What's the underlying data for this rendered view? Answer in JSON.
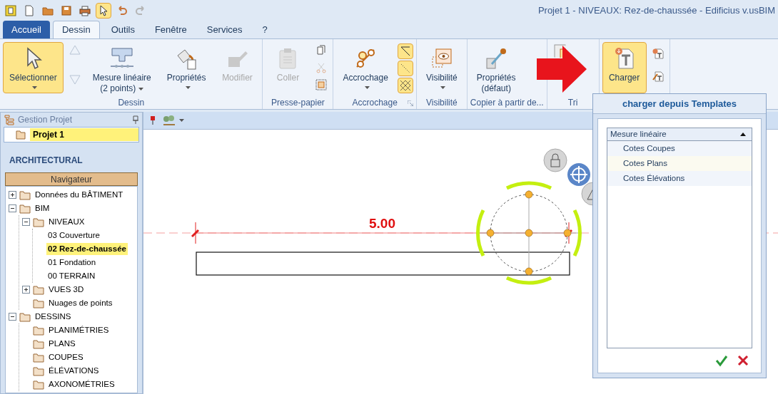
{
  "window": {
    "title": "Projet 1 -  NIVEAUX: Rez-de-chaussée - Edificius v.usBIM"
  },
  "quick_access": [
    {
      "kind": "app",
      "on": false
    },
    {
      "kind": "new",
      "on": false
    },
    {
      "kind": "open",
      "on": false
    },
    {
      "kind": "save",
      "on": false
    },
    {
      "kind": "print",
      "on": false
    },
    {
      "kind": "pointer",
      "on": true
    },
    {
      "kind": "undo",
      "on": false
    },
    {
      "kind": "redo",
      "on": false
    }
  ],
  "tabs": [
    {
      "label": "Accueil",
      "kind": "app",
      "selected": false
    },
    {
      "label": "Dessin",
      "kind": "tab",
      "selected": true
    },
    {
      "label": "Outils",
      "kind": "tab",
      "selected": false
    },
    {
      "label": "Fenêtre",
      "kind": "tab",
      "selected": false
    },
    {
      "label": "Services",
      "kind": "tab",
      "selected": false
    },
    {
      "label": "?",
      "kind": "tab",
      "selected": false
    }
  ],
  "ribbon": [
    {
      "label": "Dessin",
      "buttons": [
        {
          "kind": "select",
          "lines": [
            "Sélectionner"
          ],
          "caret": true,
          "active": true,
          "disabled": false
        },
        {
          "kind": "updown"
        },
        {
          "kind": "measure",
          "lines": [
            "Mesure linéaire",
            "(2 points)"
          ],
          "caret": true,
          "active": false,
          "disabled": false
        },
        {
          "kind": "paint",
          "lines": [
            "Propriétés"
          ],
          "caret": true,
          "active": false,
          "disabled": false
        },
        {
          "kind": "modify",
          "lines": [
            "Modifier"
          ],
          "active": false,
          "disabled": true
        }
      ]
    },
    {
      "label": "Presse-papier",
      "buttons": [
        {
          "kind": "paste",
          "lines": [
            "Coller"
          ],
          "active": false,
          "disabled": true
        },
        {
          "kind": "clip"
        }
      ]
    },
    {
      "label": "Accrochage",
      "launcher": true,
      "buttons": [
        {
          "kind": "snap",
          "lines": [
            "Accrochage"
          ],
          "caret": true,
          "active": false,
          "disabled": false
        },
        {
          "kind": "snaptoggles",
          "toggles": [
            {
              "on": true
            },
            {
              "on": true
            },
            {
              "on": true
            }
          ]
        }
      ]
    },
    {
      "label": "Visibilité",
      "buttons": [
        {
          "kind": "eye",
          "lines": [
            "Visibilité"
          ],
          "caret": true,
          "active": false,
          "disabled": false
        }
      ]
    },
    {
      "label": "Copier à partir de...",
      "buttons": [
        {
          "kind": "dropper",
          "lines": [
            "Propriétés",
            "(défaut)"
          ],
          "active": false,
          "disabled": false
        }
      ]
    },
    {
      "label": "Tri",
      "buttons": [
        {
          "kind": "sort",
          "active": false,
          "disabled": false
        }
      ]
    },
    {
      "buttons": [
        {
          "kind": "template",
          "lines": [
            "Charger"
          ],
          "active": true,
          "disabled": false
        },
        {
          "kind": "templatesmall"
        }
      ]
    }
  ],
  "sidebar": {
    "title": "Gestion Projet",
    "project": {
      "label": "Projet 1",
      "selected": true
    },
    "section": "ARCHITECTURAL",
    "navigator": "Navigateur",
    "tree": [
      {
        "label": "Données du BÂTIMENT",
        "expanded": false,
        "selected": false
      },
      {
        "label": "BIM",
        "expanded": true,
        "selected": false,
        "children": [
          {
            "label": "NIVEAUX",
            "expanded": true,
            "selected": false,
            "children": [
              {
                "label": "03 Couverture",
                "selected": false
              },
              {
                "label": "02 Rez-de-chaussée",
                "selected": true
              },
              {
                "label": "01 Fondation",
                "selected": false
              },
              {
                "label": "00 TERRAIN",
                "selected": false
              }
            ]
          },
          {
            "label": "VUES 3D",
            "expanded": false,
            "selected": false
          },
          {
            "label": "Nuages de points",
            "selected": false
          }
        ]
      },
      {
        "label": "DESSINS",
        "expanded": true,
        "selected": false,
        "children": [
          {
            "label": "PLANIMÉTRIES",
            "selected": false
          },
          {
            "label": "PLANS",
            "selected": false
          },
          {
            "label": "COUPES",
            "selected": false
          },
          {
            "label": "ÉLÉVATIONS",
            "selected": false
          },
          {
            "label": "AXONOMÉTRIES",
            "selected": false
          }
        ]
      }
    ]
  },
  "canvas": {
    "dimension": "5.00"
  },
  "popup": {
    "title": "charger depuis Templates",
    "combo": {
      "value": "Mesure linéaire",
      "expanded": true
    },
    "items": [
      {
        "label": "Cotes Coupes",
        "selected": false
      },
      {
        "label": "Cotes Plans",
        "selected": true
      },
      {
        "label": "Cotes Élévations",
        "selected": false
      }
    ]
  }
}
